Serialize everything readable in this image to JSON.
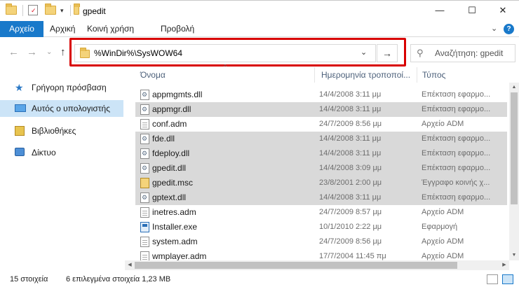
{
  "window": {
    "title": "gpedit",
    "minimize": "—",
    "maximize": "☐",
    "close": "✕"
  },
  "ribbon": {
    "tabs": [
      "Αρχείο",
      "Αρχική",
      "Κοινή χρήση",
      "Προβολή"
    ],
    "collapse": "⌄",
    "help": "?"
  },
  "nav": {
    "back": "←",
    "forward": "→",
    "recent": "⌄",
    "up": "↑",
    "address": "%WinDir%\\SysWOW64",
    "address_dropdown": "⌄",
    "go": "→",
    "search_icon": "⚲",
    "search_placeholder": "Αναζήτηση: gpedit"
  },
  "sidebar": {
    "items": [
      {
        "label": "Γρήγορη πρόσβαση",
        "icon": "star-icon",
        "selected": false
      },
      {
        "label": "Αυτός ο υπολογιστής",
        "icon": "computer-icon",
        "selected": true
      },
      {
        "label": "Βιβλιοθήκες",
        "icon": "libraries-icon",
        "selected": false
      },
      {
        "label": "Δίκτυο",
        "icon": "network-icon",
        "selected": false
      }
    ]
  },
  "columns": {
    "name": "Όνομα",
    "date": "Ημερομηνία τροποποί...",
    "type": "Τύπος",
    "sort_indicator": "^"
  },
  "files": [
    {
      "name": "appmgmts.dll",
      "date": "14/4/2008 3:11 μμ",
      "type": "Επέκταση εφαρμο...",
      "icon": "dll",
      "selected": false
    },
    {
      "name": "appmgr.dll",
      "date": "14/4/2008 3:11 μμ",
      "type": "Επέκταση εφαρμο...",
      "icon": "dll",
      "selected": true
    },
    {
      "name": "conf.adm",
      "date": "24/7/2009 8:56 μμ",
      "type": "Αρχείο ADM",
      "icon": "adm",
      "selected": false
    },
    {
      "name": "fde.dll",
      "date": "14/4/2008 3:11 μμ",
      "type": "Επέκταση εφαρμο...",
      "icon": "dll",
      "selected": true
    },
    {
      "name": "fdeploy.dll",
      "date": "14/4/2008 3:11 μμ",
      "type": "Επέκταση εφαρμο...",
      "icon": "dll",
      "selected": true
    },
    {
      "name": "gpedit.dll",
      "date": "14/4/2008 3:09 μμ",
      "type": "Επέκταση εφαρμο...",
      "icon": "dll",
      "selected": true
    },
    {
      "name": "gpedit.msc",
      "date": "23/8/2001 2:00 μμ",
      "type": "Έγγραφο κοινής χ...",
      "icon": "msc",
      "selected": true
    },
    {
      "name": "gptext.dll",
      "date": "14/4/2008 3:11 μμ",
      "type": "Επέκταση εφαρμο...",
      "icon": "dll",
      "selected": true
    },
    {
      "name": "inetres.adm",
      "date": "24/7/2009 8:57 μμ",
      "type": "Αρχείο ADM",
      "icon": "adm",
      "selected": false
    },
    {
      "name": "Installer.exe",
      "date": "10/1/2010 2:22 μμ",
      "type": "Εφαρμογή",
      "icon": "exe",
      "selected": false
    },
    {
      "name": "system.adm",
      "date": "24/7/2009 8:56 μμ",
      "type": "Αρχείο ADM",
      "icon": "adm",
      "selected": false
    },
    {
      "name": "wmplayer.adm",
      "date": "17/7/2004 11:45 πμ",
      "type": "Αρχείο ADM",
      "icon": "adm",
      "selected": false
    }
  ],
  "status": {
    "count": "15 στοιχεία",
    "selected": "6 επιλεγμένα στοιχεία 1,23 MB"
  }
}
